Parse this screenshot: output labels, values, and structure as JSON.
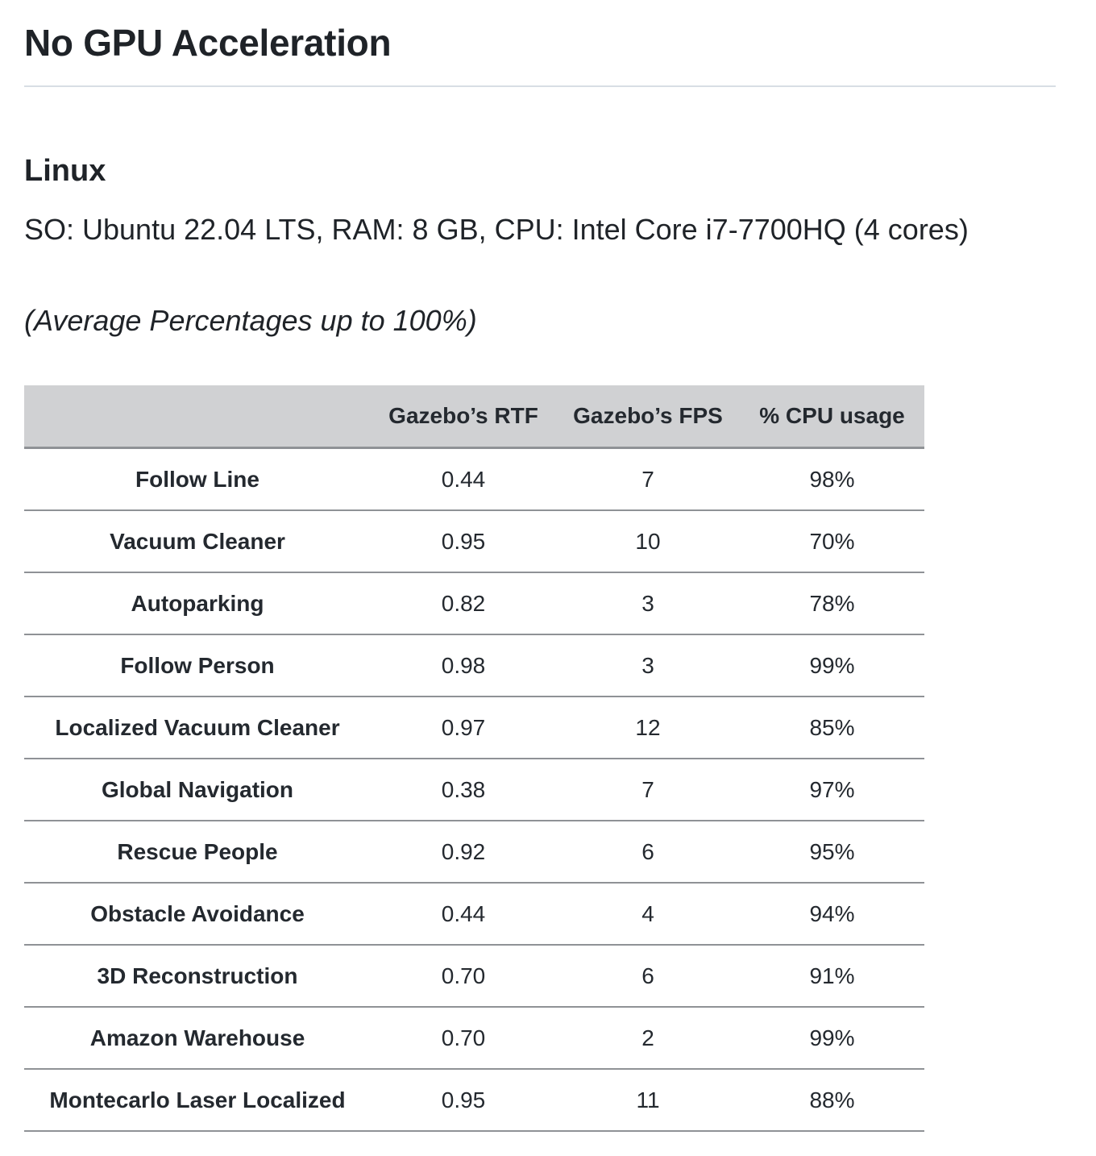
{
  "page": {
    "title": "No GPU Acceleration"
  },
  "section": {
    "title": "Linux",
    "specs": "SO: Ubuntu 22.04 LTS, RAM: 8 GB, CPU: Intel Core i7-7700HQ (4 cores)",
    "note": "(Average Percentages up to 100%)"
  },
  "table": {
    "headers": [
      "",
      "Gazebo’s RTF",
      "Gazebo’s FPS",
      "% CPU usage"
    ],
    "rows": [
      [
        "Follow Line",
        "0.44",
        "7",
        "98%"
      ],
      [
        "Vacuum Cleaner",
        "0.95",
        "10",
        "70%"
      ],
      [
        "Autoparking",
        "0.82",
        "3",
        "78%"
      ],
      [
        "Follow Person",
        "0.98",
        "3",
        "99%"
      ],
      [
        "Localized Vacuum Cleaner",
        "0.97",
        "12",
        "85%"
      ],
      [
        "Global Navigation",
        "0.38",
        "7",
        "97%"
      ],
      [
        "Rescue People",
        "0.92",
        "6",
        "95%"
      ],
      [
        "Obstacle Avoidance",
        "0.44",
        "4",
        "94%"
      ],
      [
        "3D Reconstruction",
        "0.70",
        "6",
        "91%"
      ],
      [
        "Amazon Warehouse",
        "0.70",
        "2",
        "99%"
      ],
      [
        "Montecarlo Laser Localized",
        "0.95",
        "11",
        "88%"
      ]
    ]
  }
}
